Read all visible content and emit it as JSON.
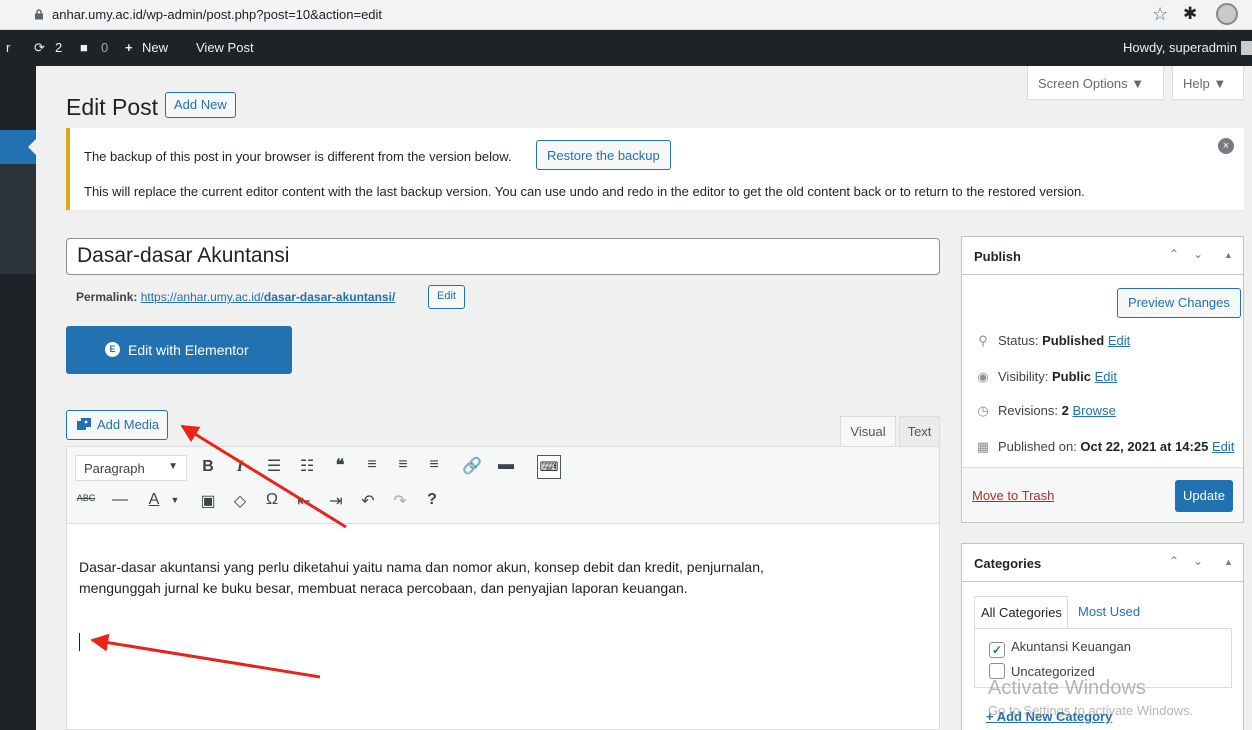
{
  "browser": {
    "url": "anhar.umy.ac.id/wp-admin/post.php?post=10&action=edit"
  },
  "adminbar": {
    "site_initial": "r",
    "updates_count": "2",
    "comments_count": "0",
    "new_label": "New",
    "view_post_label": "View Post",
    "howdy": "Howdy, superadmin"
  },
  "header": {
    "title": "Edit Post",
    "add_new": "Add New",
    "screen_options": "Screen Options ▼",
    "help": "Help ▼"
  },
  "notice": {
    "line1": "The backup of this post in your browser is different from the version below.",
    "restore": "Restore the backup",
    "line2": "This will replace the current editor content with the last backup version. You can use undo and redo in the editor to get the old content back or to return to the restored version."
  },
  "post": {
    "title": "Dasar-dasar Akuntansi",
    "permalink_label": "Permalink:",
    "permalink_base": "https://anhar.umy.ac.id/",
    "permalink_slug": "dasar-dasar-akuntansi/",
    "permalink_edit": "Edit"
  },
  "elementor": {
    "label": "Edit with Elementor"
  },
  "editor": {
    "add_media": "Add Media",
    "tab_visual": "Visual",
    "tab_text": "Text",
    "format": "Paragraph",
    "content_line1": "Dasar-dasar akuntansi yang perlu diketahui yaitu nama dan nomor akun, konsep debit dan kredit, penjurnalan,",
    "content_line2": "mengunggah jurnal ke buku besar, membuat neraca percobaan, dan penyajian laporan keuangan."
  },
  "publish": {
    "title": "Publish",
    "preview": "Preview Changes",
    "status_label": "Status:",
    "status_value": "Published",
    "visibility_label": "Visibility:",
    "visibility_value": "Public",
    "revisions_label": "Revisions:",
    "revisions_value": "2",
    "browse": "Browse",
    "published_label": "Published on:",
    "published_value": "Oct 22, 2021 at 14:25",
    "edit": "Edit",
    "trash": "Move to Trash",
    "update": "Update"
  },
  "categories": {
    "title": "Categories",
    "tab_all": "All Categories",
    "tab_most": "Most Used",
    "items": [
      {
        "label": "Akuntansi Keuangan",
        "checked": true
      },
      {
        "label": "Uncategorized",
        "checked": false
      }
    ],
    "add_new": "+ Add New Category"
  },
  "watermark": {
    "line1": "Activate Windows",
    "line2": "Go to Settings to activate Windows."
  },
  "colors": {
    "accent": "#2271b1",
    "adminbar": "#1d2327",
    "notice_border": "#dba617",
    "annotation_arrow": "#e8241a"
  }
}
